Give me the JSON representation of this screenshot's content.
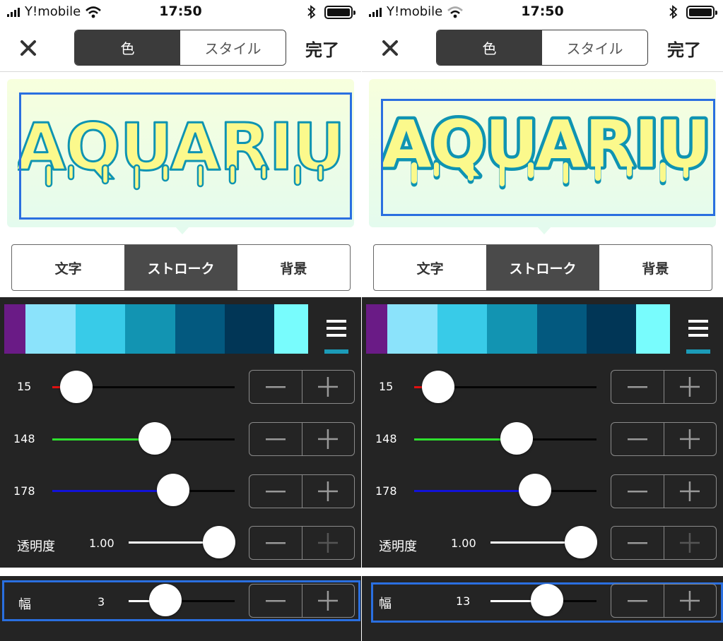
{
  "status": {
    "carrier": "Y!mobile",
    "time": "17:50"
  },
  "nav": {
    "tab_color": "色",
    "tab_style": "スタイル",
    "done": "完了"
  },
  "preview": {
    "text": "AQUARIU",
    "fill_color": "#fbf98c"
  },
  "layer_tabs": {
    "text": "文字",
    "stroke": "ストローク",
    "background": "背景"
  },
  "palette": [
    "#6a1b86",
    "#8be3fb",
    "#38cbe8",
    "#1294b2",
    "#03597f",
    "#013656",
    "#78fcfd"
  ],
  "sliders": {
    "red": {
      "value": "15"
    },
    "green": {
      "value": "148"
    },
    "blue": {
      "value": "178"
    },
    "opacity": {
      "label": "透明度",
      "value": "1.00"
    }
  },
  "width": {
    "label": "幅"
  },
  "panels": [
    {
      "stroke_width": "3"
    },
    {
      "stroke_width": "13"
    }
  ],
  "colors": {
    "accent": "#2a6fe0",
    "stroke": "#0f94b2",
    "dark_bg": "#242424"
  }
}
